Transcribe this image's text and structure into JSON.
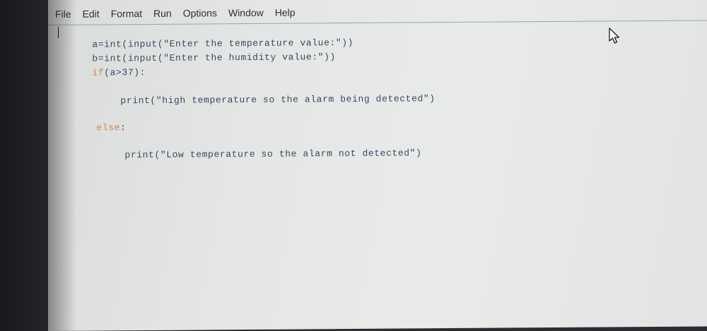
{
  "menubar": {
    "items": [
      "File",
      "Edit",
      "Format",
      "Run",
      "Options",
      "Window",
      "Help"
    ]
  },
  "editor": {
    "lines": [
      {
        "prefix": "",
        "keyword": "",
        "code": "a=int(input(\"Enter the temperature value:\"))"
      },
      {
        "prefix": "",
        "keyword": "",
        "code": "b=int(input(\"Enter the humidity value:\"))"
      },
      {
        "prefix": "",
        "keyword": "if",
        "code": "(a>37):"
      },
      {
        "prefix": "",
        "keyword": "",
        "code": "print(\"high temperature so the alarm being detected\")"
      },
      {
        "prefix": "",
        "keyword": "else",
        "code": ":"
      },
      {
        "prefix": "",
        "keyword": "",
        "code": "print(\"Low temperature so the alarm not detected\")"
      }
    ]
  },
  "cursor_icon": "mouse-pointer-icon"
}
